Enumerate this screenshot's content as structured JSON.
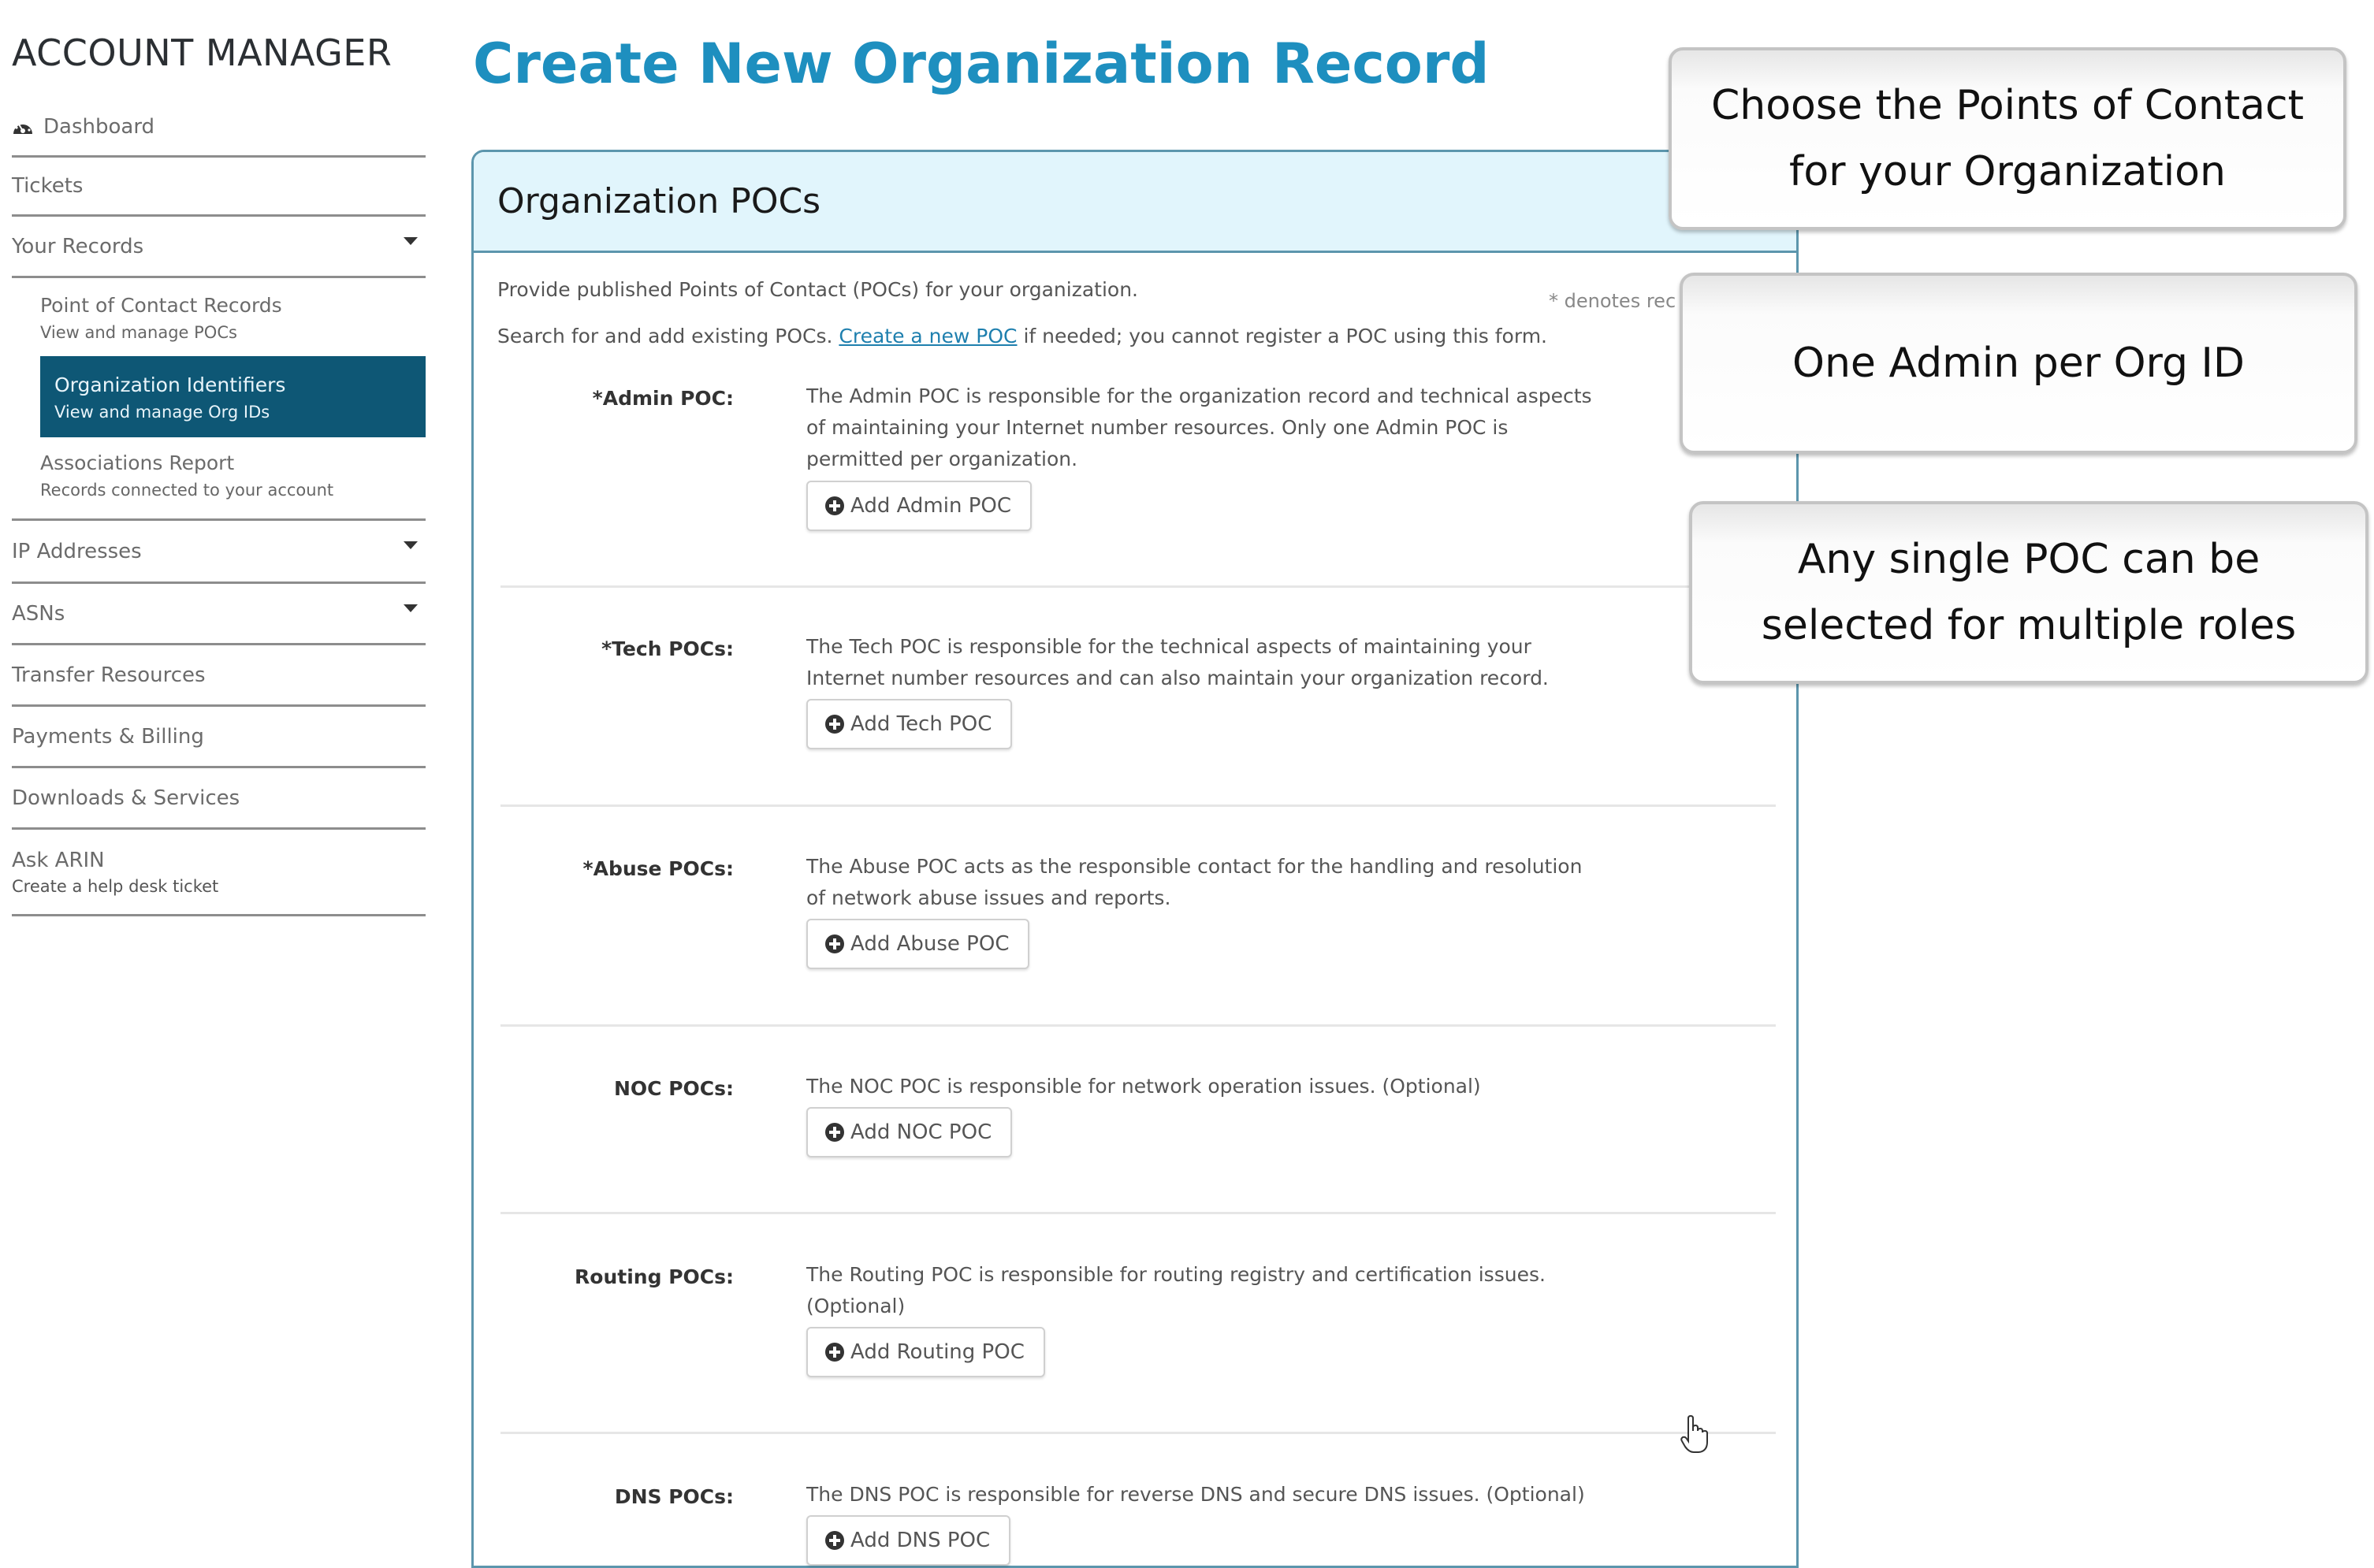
{
  "sidebar": {
    "brand": "ACCOUNT MANAGER",
    "items": [
      {
        "label": "Dashboard",
        "icon": "dashboard-icon"
      },
      {
        "label": "Tickets"
      },
      {
        "label": "Your Records",
        "expandable": true
      },
      {
        "label": "IP Addresses",
        "expandable": true
      },
      {
        "label": "ASNs",
        "expandable": true
      },
      {
        "label": "Transfer Resources"
      },
      {
        "label": "Payments & Billing"
      },
      {
        "label": "Downloads & Services"
      },
      {
        "label": "Ask ARIN",
        "sublabel": "Create a help desk ticket"
      }
    ],
    "your_records_sub": [
      {
        "label": "Point of Contact Records",
        "sublabel": "View and manage POCs"
      },
      {
        "label": "Organization Identifiers",
        "sublabel": "View and manage Org IDs",
        "active": true
      },
      {
        "label": "Associations Report",
        "sublabel": "Records connected to your account"
      }
    ]
  },
  "main": {
    "page_title": "Create New Organization Record",
    "panel": {
      "title": "Organization POCs",
      "intro_1": "Provide published Points of Contact (POCs) for your organization.",
      "intro_2_prefix": "Search for and add existing POCs. ",
      "intro_2_link": "Create a new POC",
      "intro_2_suffix": " if needed; you cannot register a POC using this form.",
      "required_note": "* denotes rec",
      "pocs": [
        {
          "label": "*Admin POC:",
          "description": "The Admin POC is responsible for the organization record and technical aspects of maintaining your Internet number resources. Only one Admin POC is permitted per organization.",
          "button": "Add Admin POC"
        },
        {
          "label": "*Tech POCs:",
          "description": "The Tech POC is responsible for the technical aspects of maintaining your Internet number resources and can also maintain your organization record.",
          "button": "Add Tech POC"
        },
        {
          "label": "*Abuse POCs:",
          "description": "The Abuse POC acts as the responsible contact for the handling and resolution of network abuse issues and reports.",
          "button": "Add Abuse POC"
        },
        {
          "label": "NOC POCs:",
          "description": "The NOC POC is responsible for network operation issues. (Optional)",
          "button": "Add NOC POC"
        },
        {
          "label": "Routing POCs:",
          "description": "The Routing POC is responsible for routing registry and certification issues. (Optional)",
          "button": "Add Routing POC"
        },
        {
          "label": "DNS POCs:",
          "description": "The DNS POC is responsible for reverse DNS and secure DNS issues. (Optional)",
          "button": "Add DNS POC"
        }
      ]
    }
  },
  "callouts": [
    {
      "text": "Choose the Points of Contact for your Organization"
    },
    {
      "text": "One Admin per Org ID"
    },
    {
      "text": "Any single POC can be selected for multiple roles"
    }
  ],
  "colors": {
    "title_accent": "#1e8fbf",
    "active_nav_bg": "#0e5775",
    "panel_header_bg": "#e1f5fc",
    "panel_border": "#5c96ad",
    "link": "#1e7fae"
  }
}
